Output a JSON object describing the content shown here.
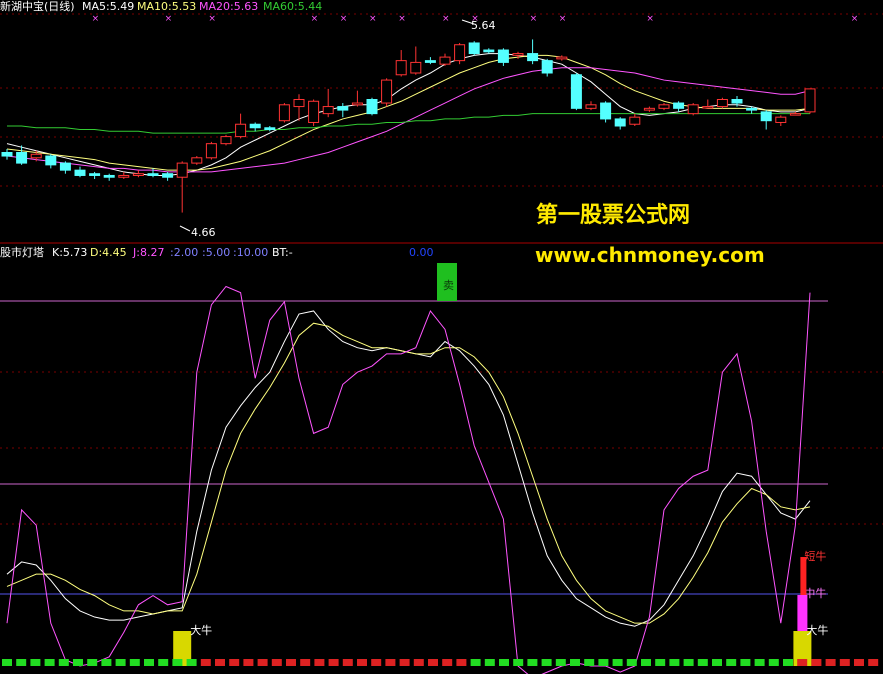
{
  "header": {
    "stock_name": "新湖中宝(日线)",
    "ma5": "MA5:5.49",
    "ma10": "MA10:5.53",
    "ma20": "MA20:5.63",
    "ma60": "MA60:5.44"
  },
  "indicator_header": {
    "name": "股市灯塔",
    "k": "K:5.73",
    "d": "D:4.45",
    "j": "J:8.27",
    "p2": ":2.00",
    "p5": ":5.00",
    "p10": ":10.00",
    "bt": "BT:-",
    "extra": "0.00"
  },
  "annotations": {
    "high_label": "5.64",
    "low_label": "4.66",
    "sell_label": "卖",
    "bull_big": "大牛",
    "bull_mid": "中牛",
    "bull_strong": "短牛"
  },
  "watermark": {
    "title": "第一股票公式网",
    "url": "www.chnmoney.com"
  },
  "colors": {
    "up": "#ff3333",
    "down": "#54ffff",
    "ma5": "#ffffff",
    "ma10": "#ffff7f",
    "ma20": "#ff55ff",
    "ma60": "#33cc33",
    "grid": "#7a0000"
  },
  "chart_data": [
    {
      "type": "candlestick",
      "title": "新湖中宝(日线)",
      "ylim": [
        4.55,
        5.75
      ],
      "candles": [
        [
          5.0,
          4.98,
          5.02,
          4.96
        ],
        [
          5.0,
          4.94,
          5.04,
          4.93
        ],
        [
          4.97,
          4.99,
          5.01,
          4.95
        ],
        [
          4.98,
          4.93,
          4.99,
          4.91
        ],
        [
          4.94,
          4.9,
          4.95,
          4.88
        ],
        [
          4.9,
          4.87,
          4.92,
          4.86
        ],
        [
          4.88,
          4.87,
          4.89,
          4.85
        ],
        [
          4.87,
          4.86,
          4.88,
          4.84
        ],
        [
          4.86,
          4.87,
          4.89,
          4.85
        ],
        [
          4.87,
          4.88,
          4.9,
          4.86
        ],
        [
          4.88,
          4.87,
          4.91,
          4.86
        ],
        [
          4.88,
          4.86,
          4.89,
          4.84
        ],
        [
          4.86,
          4.94,
          4.95,
          4.66
        ],
        [
          4.94,
          4.97,
          4.98,
          4.93
        ],
        [
          4.97,
          5.05,
          5.06,
          4.96
        ],
        [
          5.05,
          5.09,
          5.1,
          5.04
        ],
        [
          5.09,
          5.16,
          5.22,
          5.08
        ],
        [
          5.16,
          5.14,
          5.17,
          5.12
        ],
        [
          5.14,
          5.13,
          5.15,
          5.12
        ],
        [
          5.18,
          5.27,
          5.28,
          5.17
        ],
        [
          5.26,
          5.3,
          5.33,
          5.18
        ],
        [
          5.17,
          5.29,
          5.3,
          5.15
        ],
        [
          5.22,
          5.26,
          5.36,
          5.2
        ],
        [
          5.26,
          5.24,
          5.28,
          5.2
        ],
        [
          5.27,
          5.28,
          5.35,
          5.26
        ],
        [
          5.3,
          5.22,
          5.31,
          5.21
        ],
        [
          5.28,
          5.41,
          5.42,
          5.26
        ],
        [
          5.44,
          5.52,
          5.58,
          5.43
        ],
        [
          5.45,
          5.51,
          5.6,
          5.44
        ],
        [
          5.52,
          5.51,
          5.54,
          5.5
        ],
        [
          5.5,
          5.54,
          5.56,
          5.49
        ],
        [
          5.52,
          5.61,
          5.62,
          5.5
        ],
        [
          5.62,
          5.56,
          5.63,
          5.55
        ],
        [
          5.58,
          5.57,
          5.59,
          5.56
        ],
        [
          5.58,
          5.51,
          5.59,
          5.49
        ],
        [
          5.55,
          5.56,
          5.57,
          5.53
        ],
        [
          5.56,
          5.52,
          5.64,
          5.5
        ],
        [
          5.52,
          5.45,
          5.53,
          5.43
        ],
        [
          5.53,
          5.54,
          5.55,
          5.52
        ],
        [
          5.44,
          5.25,
          5.45,
          5.24
        ],
        [
          5.25,
          5.27,
          5.29,
          5.24
        ],
        [
          5.28,
          5.19,
          5.29,
          5.17
        ],
        [
          5.19,
          5.15,
          5.2,
          5.13
        ],
        [
          5.16,
          5.2,
          5.22,
          5.15
        ],
        [
          5.24,
          5.25,
          5.26,
          5.23
        ],
        [
          5.25,
          5.27,
          5.28,
          5.24
        ],
        [
          5.28,
          5.25,
          5.29,
          5.23
        ],
        [
          5.22,
          5.27,
          5.28,
          5.21
        ],
        [
          5.26,
          5.26,
          5.3,
          5.25
        ],
        [
          5.26,
          5.3,
          5.31,
          5.25
        ],
        [
          5.3,
          5.28,
          5.32,
          5.26
        ],
        [
          5.25,
          5.24,
          5.26,
          5.22
        ],
        [
          5.23,
          5.18,
          5.24,
          5.13
        ],
        [
          5.17,
          5.2,
          5.21,
          5.15
        ],
        [
          5.22,
          5.22,
          5.23,
          5.21
        ],
        [
          5.23,
          5.36,
          5.36,
          5.22
        ]
      ],
      "series": [
        {
          "name": "MA5",
          "values": [
            5.05,
            5.03,
            5.01,
            4.99,
            4.97,
            4.95,
            4.93,
            4.91,
            4.89,
            4.88,
            4.87,
            4.87,
            4.88,
            4.9,
            4.93,
            4.97,
            5.03,
            5.07,
            5.11,
            5.15,
            5.19,
            5.22,
            5.24,
            5.26,
            5.27,
            5.27,
            5.3,
            5.36,
            5.41,
            5.45,
            5.5,
            5.53,
            5.55,
            5.56,
            5.56,
            5.55,
            5.54,
            5.52,
            5.5,
            5.45,
            5.4,
            5.33,
            5.26,
            5.22,
            5.21,
            5.22,
            5.23,
            5.25,
            5.26,
            5.27,
            5.27,
            5.26,
            5.24,
            5.23,
            5.23,
            5.25
          ]
        },
        {
          "name": "MA10",
          "values": [
            5.02,
            5.01,
            5.0,
            4.99,
            4.98,
            4.97,
            4.96,
            4.94,
            4.93,
            4.92,
            4.91,
            4.9,
            4.9,
            4.9,
            4.91,
            4.93,
            4.95,
            4.98,
            5.01,
            5.05,
            5.09,
            5.13,
            5.16,
            5.19,
            5.21,
            5.23,
            5.26,
            5.29,
            5.33,
            5.37,
            5.41,
            5.45,
            5.48,
            5.51,
            5.53,
            5.54,
            5.55,
            5.55,
            5.54,
            5.51,
            5.48,
            5.44,
            5.39,
            5.35,
            5.32,
            5.29,
            5.27,
            5.26,
            5.25,
            5.25,
            5.25,
            5.25,
            5.24,
            5.24,
            5.24,
            5.25
          ]
        },
        {
          "name": "MA20",
          "values": [
            4.98,
            4.97,
            4.96,
            4.95,
            4.94,
            4.93,
            4.92,
            4.91,
            4.91,
            4.9,
            4.9,
            4.89,
            4.89,
            4.89,
            4.89,
            4.9,
            4.91,
            4.92,
            4.93,
            4.94,
            4.96,
            4.98,
            5.0,
            5.03,
            5.06,
            5.09,
            5.12,
            5.16,
            5.2,
            5.24,
            5.28,
            5.32,
            5.36,
            5.39,
            5.42,
            5.44,
            5.46,
            5.47,
            5.48,
            5.48,
            5.48,
            5.47,
            5.46,
            5.45,
            5.43,
            5.41,
            5.4,
            5.39,
            5.38,
            5.37,
            5.36,
            5.35,
            5.34,
            5.33,
            5.33,
            5.35
          ]
        },
        {
          "name": "MA60",
          "values": [
            5.15,
            5.15,
            5.14,
            5.14,
            5.14,
            5.13,
            5.13,
            5.12,
            5.12,
            5.12,
            5.11,
            5.11,
            5.11,
            5.11,
            5.11,
            5.11,
            5.12,
            5.12,
            5.13,
            5.13,
            5.14,
            5.14,
            5.15,
            5.15,
            5.16,
            5.16,
            5.17,
            5.17,
            5.18,
            5.18,
            5.19,
            5.19,
            5.2,
            5.2,
            5.21,
            5.21,
            5.22,
            5.22,
            5.22,
            5.22,
            5.22,
            5.22,
            5.22,
            5.22,
            5.22,
            5.22,
            5.22,
            5.22,
            5.22,
            5.22,
            5.22,
            5.22,
            5.22,
            5.22,
            5.22,
            5.22
          ]
        }
      ]
    },
    {
      "type": "line",
      "title": "股市灯塔",
      "ylim": [
        -6,
        126
      ],
      "reference_levels": [
        2,
        5,
        10
      ],
      "series": [
        {
          "name": "K",
          "values": [
            24,
            28,
            27,
            22,
            16,
            12,
            10,
            9,
            9,
            10,
            11,
            12,
            13,
            38,
            58,
            72,
            79,
            85,
            90,
            100,
            109,
            110,
            104,
            100,
            98,
            97,
            98,
            97,
            96,
            95,
            100,
            97,
            92,
            86,
            76,
            60,
            44,
            30,
            22,
            16,
            13,
            10,
            8,
            7,
            9,
            14,
            22,
            30,
            40,
            51,
            57,
            56,
            50,
            44,
            42,
            48
          ]
        },
        {
          "name": "D",
          "values": [
            20,
            22,
            24,
            24,
            22,
            19,
            17,
            14,
            12,
            12,
            11,
            12,
            12,
            24,
            41,
            58,
            70,
            78,
            85,
            93,
            102,
            106,
            105,
            102,
            100,
            98,
            98,
            97,
            96,
            96,
            98,
            98,
            95,
            90,
            82,
            70,
            56,
            42,
            30,
            22,
            16,
            12,
            10,
            8,
            8,
            11,
            16,
            23,
            31,
            41,
            47,
            52,
            50,
            46,
            45,
            46
          ]
        },
        {
          "name": "J",
          "values": [
            8,
            45,
            40,
            8,
            -4,
            -6,
            -5,
            -3,
            5,
            14,
            17,
            14,
            15,
            90,
            112,
            118,
            116,
            88,
            107,
            113,
            88,
            70,
            72,
            86,
            90,
            92,
            96,
            96,
            98,
            110,
            104,
            86,
            66,
            54,
            42,
            -6,
            -10,
            -8,
            -6,
            -5,
            -6,
            -6,
            -8,
            -6,
            10,
            45,
            52,
            56,
            58,
            90,
            96,
            74,
            38,
            8,
            40,
            116
          ]
        }
      ],
      "signals": [
        {
          "index": 30,
          "label": "卖"
        },
        {
          "index": 12,
          "label": "大牛"
        },
        {
          "index": 54,
          "label": "大牛"
        },
        {
          "index": 54,
          "label": "中牛"
        },
        {
          "index": 54,
          "label": "短牛"
        }
      ]
    }
  ]
}
